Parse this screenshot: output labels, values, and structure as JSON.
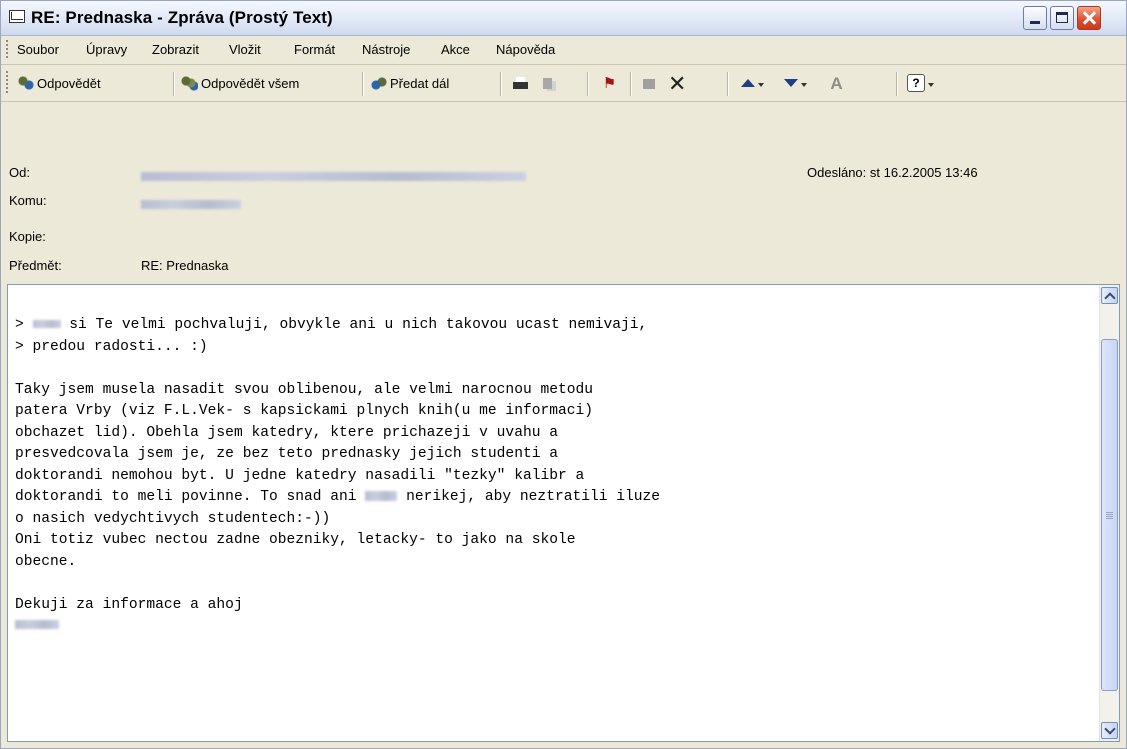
{
  "window": {
    "title": "RE: Prednaska - Zpráva (Prostý Text)"
  },
  "menu": [
    "Soubor",
    "Úpravy",
    "Zobrazit",
    "Vložit",
    "Formát",
    "Nástroje",
    "Akce",
    "Nápověda"
  ],
  "toolbar": {
    "reply": "Odpovědět",
    "reply_all": "Odpovědět všem",
    "forward": "Předat dál"
  },
  "header": {
    "from_label": "Od:",
    "to_label": "Komu:",
    "cc_label": "Kopie:",
    "subject_label": "Předmět:",
    "subject_value": "RE: Prednaska",
    "sent_label": "Odesláno:",
    "sent_value": "st 16.2.2005 13:46"
  },
  "body": {
    "line1": "> ",
    "line1_rest": " si Te velmi pochvaluji, obvykle ani u nich takovou ucast nemivaji,",
    "line2": "> predou radosti... :)",
    "para1": "Taky jsem musela nasadit svou oblibenou, ale velmi narocnou metodu\npatera Vrby (viz F.L.Vek- s kapsickami plnych knih(u me informaci)\nobchazet lid). Obehla jsem katedry, ktere prichazeji v uvahu a\npresvedcovala jsem je, ze bez teto prednasky jejich studenti a\ndoktorandi nemohou byt. U jedne katedry nasadili \"tezky\" kalibr a",
    "line_pre": "doktorandi to meli povinne. To snad ani ",
    "line_post": " nerikej, aby neztratili iluze",
    "para2": "o nasich vedychtivych studentech:-))\nOni totiz vubec nectou zadne obezniky, letacky- to jako na skole\nobecne.",
    "closing": "Dekuji za informace a ahoj"
  }
}
